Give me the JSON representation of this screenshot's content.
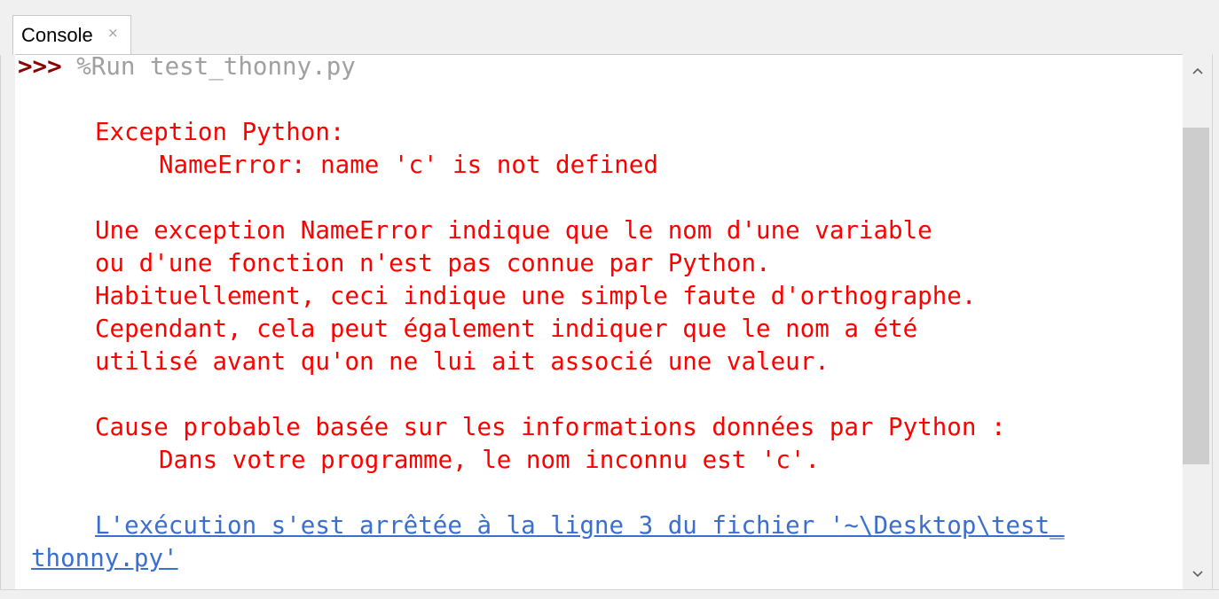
{
  "tab": {
    "label": "Console",
    "close_glyph": "×"
  },
  "console": {
    "prompt": ">>>",
    "command": "%Run test_thonny.py",
    "error_lines": [
      "Exception Python:",
      "NameError: name 'c' is not defined",
      "Une exception NameError indique que le nom d'une variable",
      "ou d'une fonction n'est pas connue par Python.",
      "Habituellement, ceci indique une simple faute d'orthographe.",
      "Cependant, cela peut également indiquer que le nom a été",
      "utilisé avant qu'on ne lui ait associé une valeur.",
      "Cause probable basée sur les informations données par Python :",
      "Dans votre programme, le nom inconnu est 'c'."
    ],
    "link_line_1": "L'exécution s'est arrêtée à la ligne 3 du fichier '~\\Desktop\\test_",
    "link_line_2": "thonny.py'"
  },
  "scrollbar": {
    "up_icon": "chevron-up-icon",
    "down_icon": "chevron-down-icon"
  },
  "colors": {
    "prompt": "#8b0000",
    "command": "#a0a0a0",
    "error_text": "#ff0000",
    "link": "#3b6fcf"
  }
}
